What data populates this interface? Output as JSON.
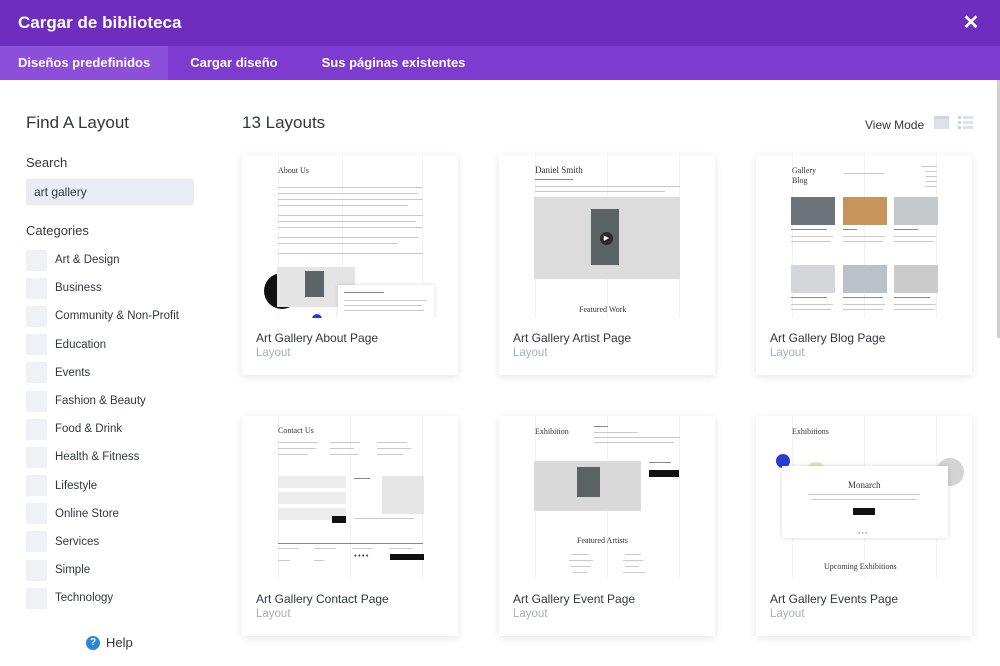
{
  "window": {
    "title": "Cargar de biblioteca",
    "close_icon": "close-icon"
  },
  "tabs": [
    {
      "label": "Diseños predefinidos",
      "active": true
    },
    {
      "label": "Cargar diseño",
      "active": false
    },
    {
      "label": "Sus páginas existentes",
      "active": false
    }
  ],
  "sidebar": {
    "heading": "Find A Layout",
    "search_label": "Search",
    "search_value": "art gallery",
    "categories_label": "Categories",
    "categories": [
      "Art & Design",
      "Business",
      "Community & Non-Profit",
      "Education",
      "Events",
      "Fashion & Beauty",
      "Food & Drink",
      "Health & Fitness",
      "Lifestyle",
      "Online Store",
      "Services",
      "Simple",
      "Technology"
    ],
    "help_label": "Help"
  },
  "main": {
    "count_label": "13 Layouts",
    "view_mode_label": "View Mode",
    "cards": [
      {
        "name": "Art Gallery About Page",
        "type": "Layout",
        "thumb_heading": "About Us"
      },
      {
        "name": "Art Gallery Artist Page",
        "type": "Layout",
        "thumb_heading": "Daniel Smith",
        "thumb_footer": "Featured Work"
      },
      {
        "name": "Art Gallery Blog Page",
        "type": "Layout",
        "thumb_heading": "Gallery Blog"
      },
      {
        "name": "Art Gallery Contact Page",
        "type": "Layout",
        "thumb_heading": "Contact Us"
      },
      {
        "name": "Art Gallery Event Page",
        "type": "Layout",
        "thumb_heading": "Exhibition",
        "thumb_footer": "Featured Artists"
      },
      {
        "name": "Art Gallery Events Page",
        "type": "Layout",
        "thumb_heading": "Exhibitions",
        "thumb_center": "Monarch",
        "thumb_footer": "Upcoming Exhibitions"
      }
    ]
  },
  "colors": {
    "title_bar": "#6f2dc0",
    "tab_bar": "#7e3bd0",
    "tab_active": "#8c4fd9",
    "muted_text": "#a2b0c1",
    "help_icon": "#2b87da"
  }
}
